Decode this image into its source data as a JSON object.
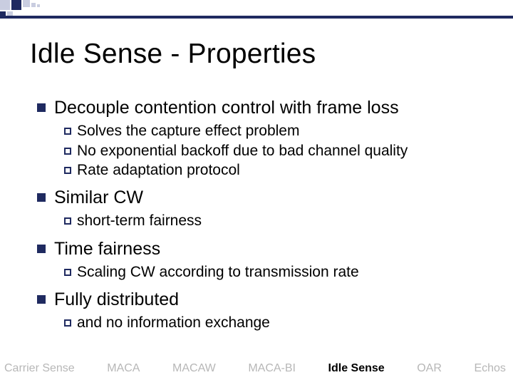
{
  "title": "Idle Sense - Properties",
  "bullets": [
    {
      "text": "Decouple contention control with frame loss",
      "subs": [
        "Solves the capture effect problem",
        "No exponential backoff due to bad channel quality",
        "Rate adaptation protocol"
      ]
    },
    {
      "text": "Similar CW",
      "subs": [
        "short-term fairness"
      ]
    },
    {
      "text": "Time fairness",
      "subs": [
        "Scaling CW according to transmission rate"
      ]
    },
    {
      "text": "Fully distributed",
      "subs": [
        "and no information exchange"
      ]
    }
  ],
  "footer": {
    "items": [
      "Carrier Sense",
      "MACA",
      "MACAW",
      "MACA-BI",
      "Idle Sense",
      "OAR",
      "Echos"
    ],
    "activeIndex": 4
  }
}
